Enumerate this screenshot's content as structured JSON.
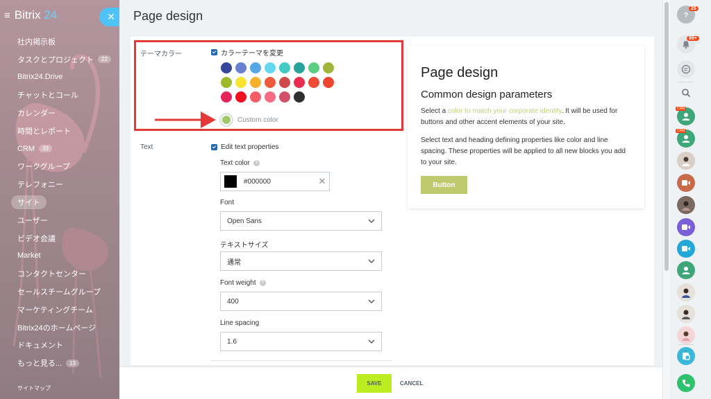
{
  "sidebar": {
    "brand": "Bitrix",
    "brand_num": "24",
    "menu": [
      {
        "label": "社内掲示板"
      },
      {
        "label": "タスクとプロジェクト",
        "badge": "22"
      },
      {
        "label": "Bitrix24.Drive"
      },
      {
        "label": "チャットとコール"
      },
      {
        "label": "カレンダー"
      },
      {
        "label": "時間とレポート"
      },
      {
        "label": "CRM",
        "badge": "33"
      },
      {
        "label": "ワークグループ"
      },
      {
        "label": "テレフォニー"
      },
      {
        "label": "サイト",
        "active": true
      },
      {
        "label": "ユーザー"
      },
      {
        "label": "ビデオ会議"
      },
      {
        "label": "Market"
      },
      {
        "label": "コンタクトセンター"
      },
      {
        "label": "セールスチームグループ"
      },
      {
        "label": "マーケティングチーム"
      },
      {
        "label": "Bitrix24のホームページ"
      },
      {
        "label": "ドキュメント"
      },
      {
        "label": "もっと見る...",
        "badge": "13"
      }
    ],
    "sitemap": "サイトマップ"
  },
  "panel": {
    "title": "Page design",
    "theme": {
      "label": "テーマカラー",
      "checkbox_label": "カラーテーマを変更",
      "swatches": [
        "#35469b",
        "#6b7fd1",
        "#56a7e6",
        "#63d8ef",
        "#41cbc3",
        "#27a39c",
        "#5dcf85",
        "#a2b53b",
        "#9cba2c",
        "#f5e531",
        "#f6b12d",
        "#f05a3c",
        "#d04a4b",
        "#ea2d4f",
        "#ec4c36",
        "#f0462f",
        "#e4235b",
        "#f0111f",
        "#f35e66",
        "#f56d85",
        "#d3506b",
        "#2f2f2f"
      ],
      "custom_label": "Custom color",
      "custom_color": "#a1c86b"
    },
    "text": {
      "label": "Text",
      "checkbox_label": "Edit text properties",
      "text_color_label": "Text color",
      "text_color_value": "#000000",
      "font_label": "Font",
      "font_value": "Open Sans",
      "size_label": "テキストサイズ",
      "size_value": "通常",
      "weight_label": "Font weight",
      "weight_value": "400",
      "spacing_label": "Line spacing",
      "spacing_value": "1.6"
    },
    "preview": {
      "title": "Page design",
      "subtitle": "Common design parameters",
      "p1_a": "Select a ",
      "p1_link": "color to match your corporate identity",
      "p1_b": ". It will be used for buttons and other accent elements of your site.",
      "p2": "Select text and heading defining properties like color and line spacing. These properties will be applied to all new blocks you add to your site.",
      "button": "Button"
    },
    "footer": {
      "save": "SAVE",
      "cancel": "CANCEL"
    }
  },
  "rightbar": {
    "help_count": "26",
    "notif_count": "99+",
    "crm_tag": "CRM"
  }
}
